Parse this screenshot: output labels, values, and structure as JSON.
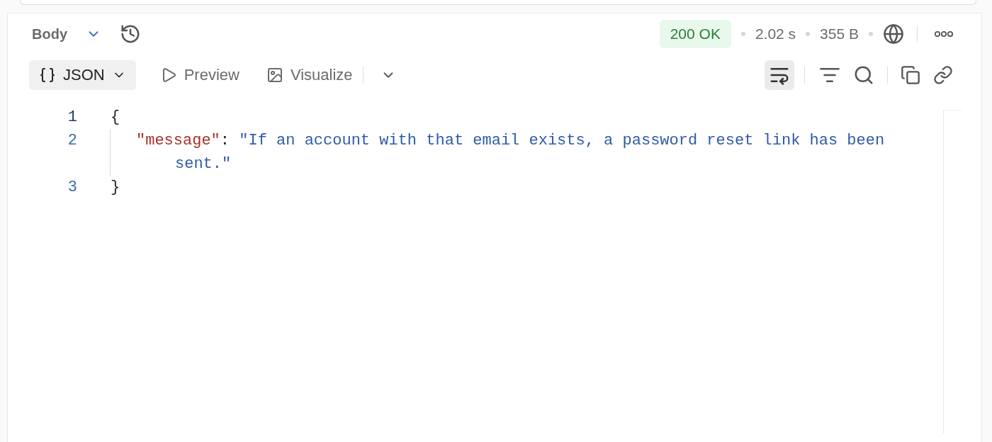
{
  "response_header": {
    "body_label": "Body",
    "status": "200 OK",
    "time": "2.02 s",
    "size": "355 B"
  },
  "view_tabs": [
    {
      "label": "JSON",
      "kind": "json",
      "selected": true
    },
    {
      "label": "Preview",
      "kind": "preview",
      "selected": false
    },
    {
      "label": "Visualize",
      "kind": "visualize",
      "selected": false
    }
  ],
  "wrap_lines": true,
  "code_lines": [
    {
      "number": "1",
      "selected": true,
      "tokens": [
        {
          "kind": "punct",
          "text": "{"
        }
      ]
    },
    {
      "number": "2",
      "selected": false,
      "tokens": [
        {
          "kind": "key",
          "text": "\"message\""
        },
        {
          "kind": "punct",
          "text": ": "
        },
        {
          "kind": "string",
          "text": "\"If an account with that email exists, a password reset link has been sent.\""
        }
      ]
    },
    {
      "number": "3",
      "selected": false,
      "tokens": [
        {
          "kind": "punct",
          "text": "}"
        }
      ]
    }
  ]
}
